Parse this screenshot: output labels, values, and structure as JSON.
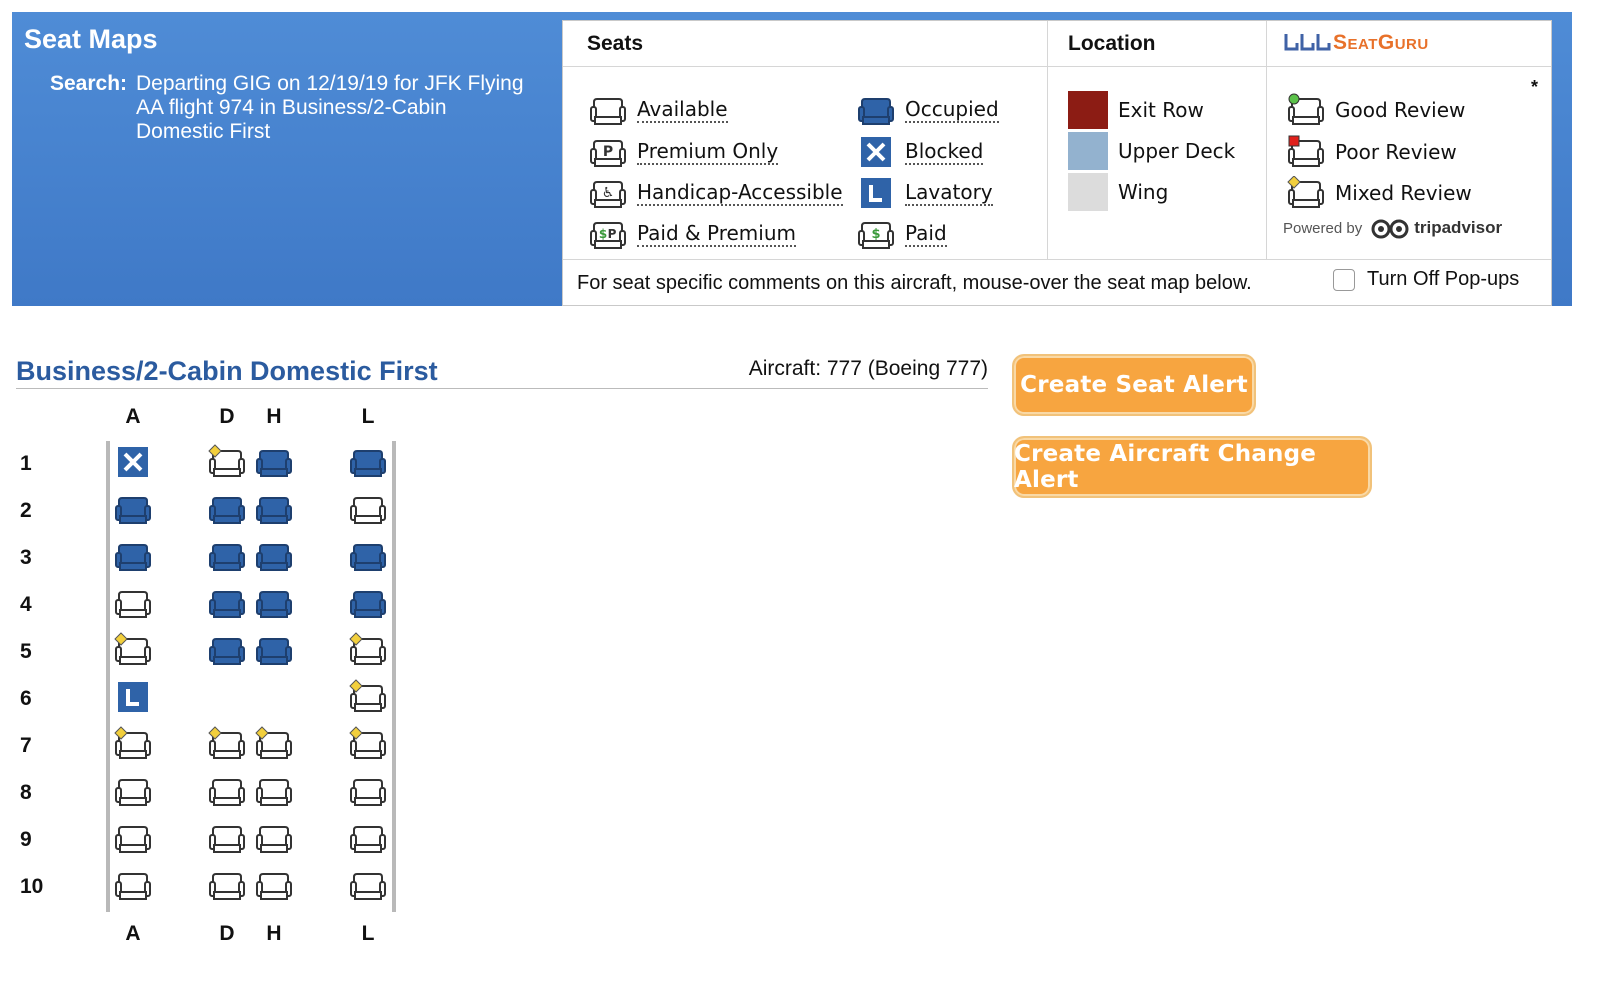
{
  "header": {
    "title": "Seat Maps",
    "search_label": "Search:",
    "search_text": "Departing GIG on 12/19/19 for JFK Flying AA flight 974 in Business/2-Cabin Domestic First"
  },
  "legend": {
    "seats_heading": "Seats",
    "location_heading": "Location",
    "brand": "SeatGuru",
    "asterisk": "*",
    "seat_types": [
      {
        "label": "Available",
        "icon": "available-seat-icon"
      },
      {
        "label": "Premium Only",
        "icon": "premium-seat-icon"
      },
      {
        "label": "Handicap-Accessible",
        "icon": "handicap-seat-icon"
      },
      {
        "label": "Paid & Premium",
        "icon": "paid-premium-seat-icon"
      },
      {
        "label": "Occupied",
        "icon": "occupied-seat-icon"
      },
      {
        "label": "Blocked",
        "icon": "blocked-seat-icon"
      },
      {
        "label": "Lavatory",
        "icon": "lavatory-icon"
      },
      {
        "label": "Paid",
        "icon": "paid-seat-icon"
      }
    ],
    "locations": [
      {
        "label": "Exit Row",
        "color": "#8c1c14"
      },
      {
        "label": "Upper Deck",
        "color": "#93b2cf"
      },
      {
        "label": "Wing",
        "color": "#dcdcdc"
      }
    ],
    "reviews": [
      {
        "label": "Good Review",
        "color": "#5bc24a"
      },
      {
        "label": "Poor Review",
        "color": "#e0201b"
      },
      {
        "label": "Mixed Review",
        "color": "#f2cf3c"
      }
    ],
    "powered_by": "Powered by",
    "tripadvisor": "tripadvisor",
    "footer_note": "For seat specific comments on this aircraft, mouse-over the seat map below.",
    "popups_label": "Turn Off Pop-ups"
  },
  "cabin": {
    "title": "Business/2-Cabin Domestic First",
    "aircraft": "Aircraft: 777 (Boeing 777)",
    "seat_alert_label": "Create Seat Alert",
    "aircraft_alert_label": "Create Aircraft Change Alert",
    "columns": [
      "A",
      "D",
      "H",
      "L"
    ],
    "rows": [
      {
        "num": "1",
        "seats": [
          "blocked",
          "mixed",
          "occupied",
          "occupied"
        ]
      },
      {
        "num": "2",
        "seats": [
          "occupied",
          "occupied",
          "occupied",
          "available"
        ]
      },
      {
        "num": "3",
        "seats": [
          "occupied",
          "occupied",
          "occupied",
          "occupied"
        ]
      },
      {
        "num": "4",
        "seats": [
          "available",
          "occupied",
          "occupied",
          "occupied"
        ]
      },
      {
        "num": "5",
        "seats": [
          "mixed",
          "occupied",
          "occupied",
          "mixed"
        ]
      },
      {
        "num": "6",
        "seats": [
          "lavatory",
          "none",
          "none",
          "mixed"
        ]
      },
      {
        "num": "7",
        "seats": [
          "mixed",
          "mixed",
          "mixed",
          "mixed"
        ]
      },
      {
        "num": "8",
        "seats": [
          "available",
          "available",
          "available",
          "available"
        ]
      },
      {
        "num": "9",
        "seats": [
          "available",
          "available",
          "available",
          "available"
        ]
      },
      {
        "num": "10",
        "seats": [
          "available",
          "available",
          "available",
          "available"
        ]
      }
    ]
  },
  "colors": {
    "banner": "#4583cf",
    "occupied": "#2f63a8",
    "cabin_title": "#2b5b9f",
    "button": "#f7a540"
  }
}
